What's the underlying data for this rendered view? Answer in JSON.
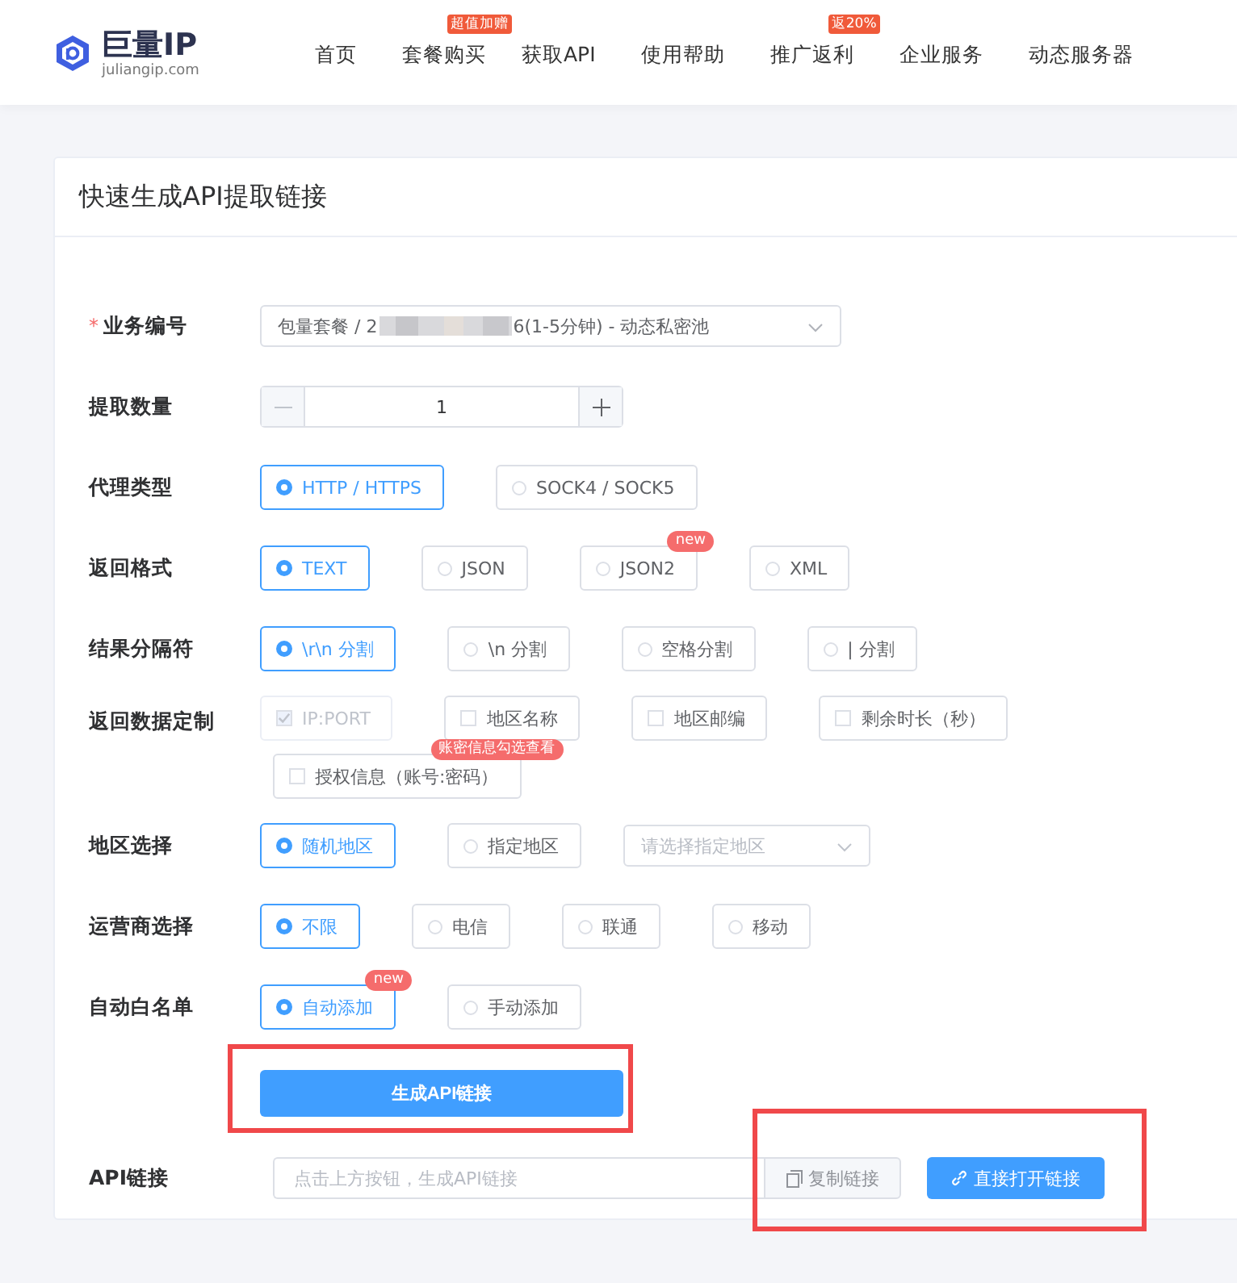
{
  "header": {
    "logo_title": "巨量IP",
    "logo_subtitle": "juliangip.com",
    "nav": [
      {
        "label": "首页"
      },
      {
        "label": "套餐购买",
        "badge": "超值加赠"
      },
      {
        "label": "获取API"
      },
      {
        "label": "使用帮助"
      },
      {
        "label": "推广返利",
        "badge": "返20%"
      },
      {
        "label": "企业服务"
      },
      {
        "label": "动态服务器"
      }
    ]
  },
  "card": {
    "title": "快速生成API提取链接"
  },
  "rows": [
    {
      "kind": "select",
      "label": "业务编号",
      "required_mark": "*",
      "value_start": "包量套餐 / 2",
      "value_end": "6(1-5分钟) - 动态私密池"
    },
    {
      "kind": "stepper",
      "label": "提取数量",
      "value": "1"
    },
    {
      "kind": "radio",
      "label": "代理类型",
      "options": [
        {
          "label": "HTTP / HTTPS",
          "selected": true
        },
        {
          "label": "SOCK4 / SOCK5",
          "selected": false
        }
      ]
    },
    {
      "kind": "radio",
      "label": "返回格式",
      "options": [
        {
          "label": "TEXT",
          "selected": true
        },
        {
          "label": "JSON",
          "selected": false
        },
        {
          "label": "JSON2",
          "selected": false,
          "badge": "new"
        },
        {
          "label": "XML",
          "selected": false
        }
      ]
    },
    {
      "kind": "radio",
      "label": "结果分隔符",
      "options": [
        {
          "label": "\\r\\n 分割",
          "selected": true
        },
        {
          "label": "\\n 分割",
          "selected": false
        },
        {
          "label": "空格分割",
          "selected": false
        },
        {
          "label": "| 分割",
          "selected": false
        }
      ]
    },
    {
      "kind": "checkbox",
      "label": "返回数据定制",
      "options": [
        {
          "label": "IP:PORT",
          "checked": true,
          "disabled": true
        },
        {
          "label": "地区名称",
          "checked": false,
          "disabled": false
        },
        {
          "label": "地区邮编",
          "checked": false,
          "disabled": false
        },
        {
          "label": "剩余时长（秒）",
          "checked": false,
          "disabled": false
        },
        {
          "label": "授权信息（账号:密码）",
          "checked": false,
          "disabled": false,
          "badge": "账密信息勾选查看"
        }
      ]
    },
    {
      "kind": "radio",
      "label": "地区选择",
      "options": [
        {
          "label": "随机地区",
          "selected": true
        },
        {
          "label": "指定地区",
          "selected": false
        }
      ],
      "select_placeholder": "请选择指定地区"
    },
    {
      "kind": "radio",
      "label": "运营商选择",
      "options": [
        {
          "label": "不限",
          "selected": true
        },
        {
          "label": "电信",
          "selected": false
        },
        {
          "label": "联通",
          "selected": false
        },
        {
          "label": "移动",
          "selected": false
        }
      ]
    },
    {
      "kind": "radio",
      "label": "自动白名单",
      "options": [
        {
          "label": "自动添加",
          "selected": true,
          "badge": "new"
        },
        {
          "label": "手动添加",
          "selected": false
        }
      ]
    },
    {
      "kind": "button",
      "label": "生成API链接",
      "highlighted": true
    },
    {
      "kind": "link",
      "label": "API链接",
      "placeholder": "点击上方按钮，生成API链接",
      "copy_label": "复制链接",
      "open_label": "直接打开链接",
      "highlighted": true
    }
  ]
}
